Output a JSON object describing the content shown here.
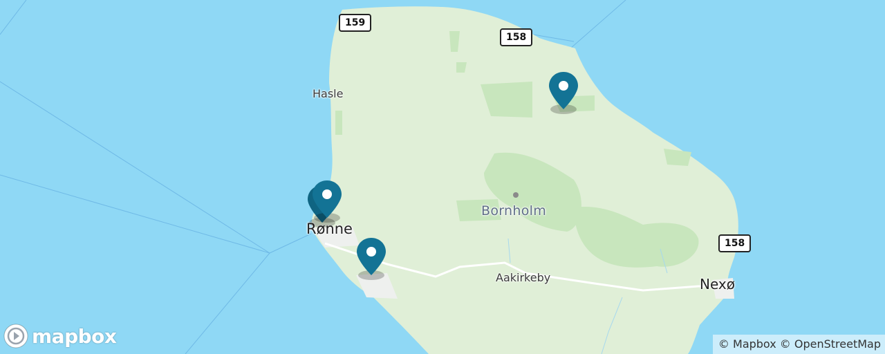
{
  "map": {
    "places": {
      "hasle": "Hasle",
      "ronne": "Rønne",
      "bornholm": "Bornholm",
      "aakirkeby": "Aakirkeby",
      "nexo": "Nexø"
    },
    "routes": {
      "r159": "159",
      "r158_north": "158",
      "r158_east": "158"
    },
    "markers": [
      "marker-1",
      "marker-2",
      "marker-3"
    ],
    "colors": {
      "water": "#8fd8f5",
      "land": "#e0efd7",
      "forest": "#c8e6bd",
      "marker": "#137395"
    }
  },
  "logo": {
    "text": "mapbox"
  },
  "attribution": {
    "mapbox": "© Mapbox",
    "osm": "© OpenStreetMap"
  }
}
